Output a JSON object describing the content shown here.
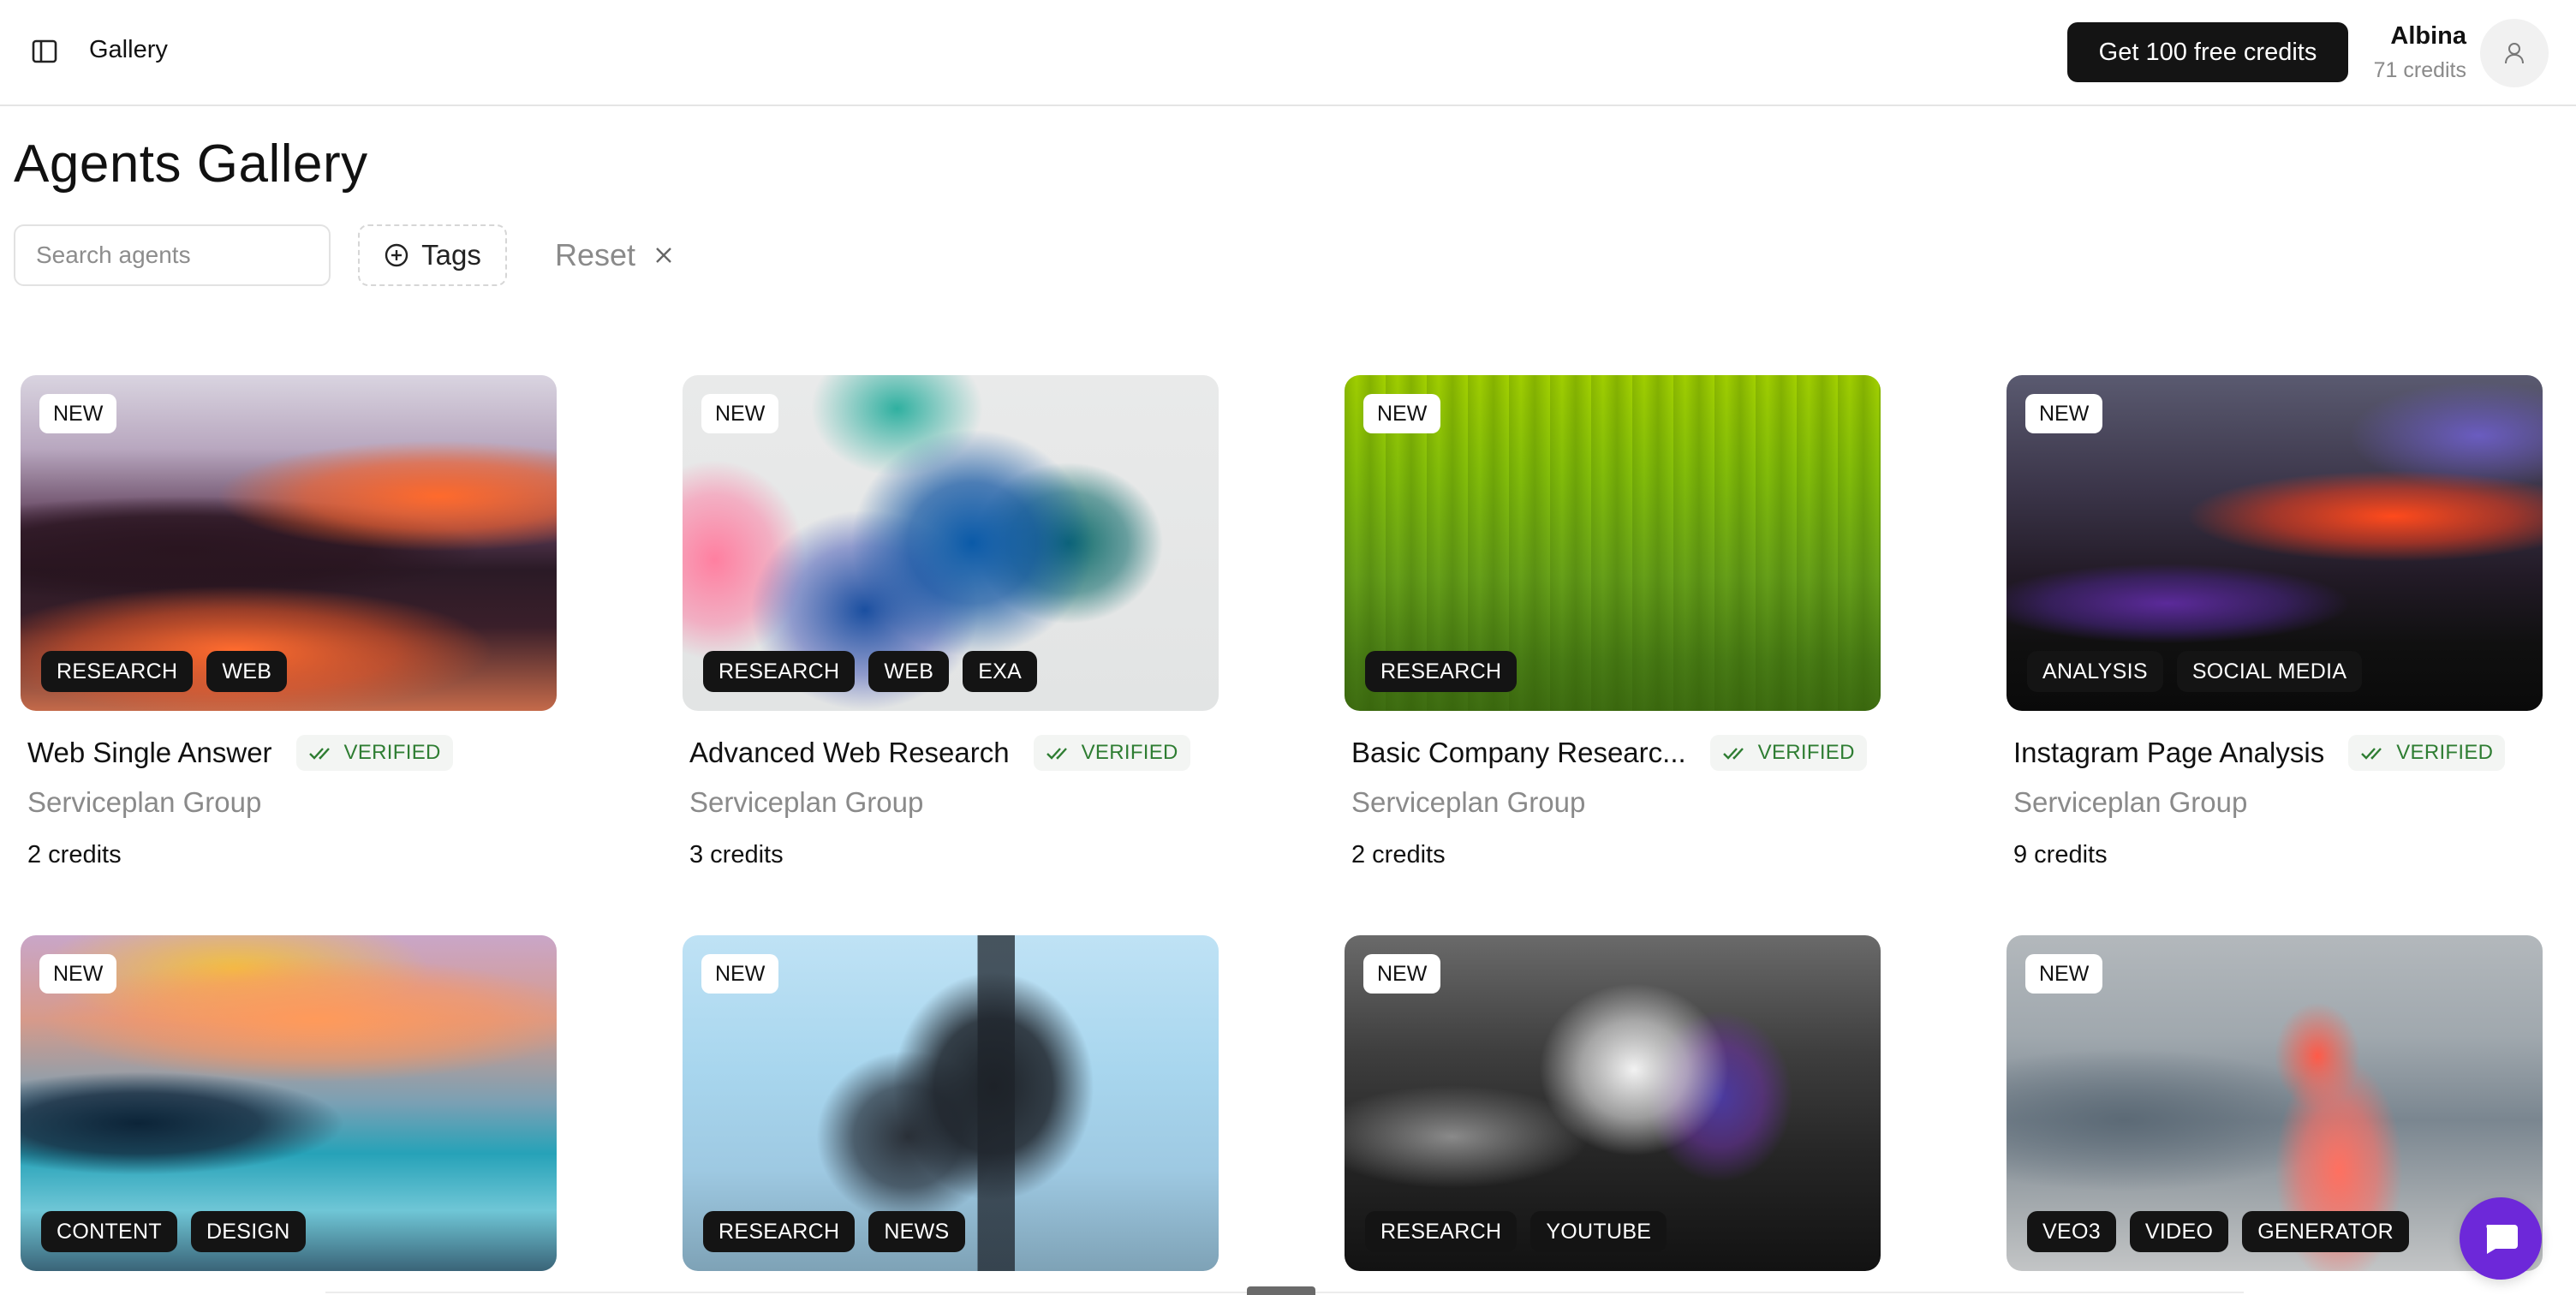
{
  "header": {
    "breadcrumb": "Gallery",
    "cta_label": "Get 100 free credits",
    "user_name": "Albina",
    "user_credits": "71 credits"
  },
  "page": {
    "title": "Agents Gallery"
  },
  "filters": {
    "search_placeholder": "Search agents",
    "tags_label": "Tags",
    "reset_label": "Reset"
  },
  "badges": {
    "new": "NEW",
    "verified": "VERIFIED"
  },
  "cards": [
    {
      "title": "Web Single Answer",
      "verified": true,
      "org": "Serviceplan Group",
      "price": "2 credits",
      "tags": [
        "RESEARCH",
        "WEB"
      ]
    },
    {
      "title": "Advanced Web Research",
      "verified": true,
      "org": "Serviceplan Group",
      "price": "3 credits",
      "tags": [
        "RESEARCH",
        "WEB",
        "EXA"
      ]
    },
    {
      "title": "Basic Company Researc...",
      "verified": true,
      "org": "Serviceplan Group",
      "price": "2 credits",
      "tags": [
        "RESEARCH"
      ]
    },
    {
      "title": "Instagram Page Analysis",
      "verified": true,
      "org": "Serviceplan Group",
      "price": "9 credits",
      "tags": [
        "ANALYSIS",
        "SOCIAL MEDIA"
      ]
    },
    {
      "tags": [
        "CONTENT",
        "DESIGN"
      ]
    },
    {
      "tags": [
        "RESEARCH",
        "NEWS"
      ]
    },
    {
      "tags": [
        "RESEARCH",
        "YOUTUBE"
      ]
    },
    {
      "tags": [
        "VEO3",
        "VIDEO",
        "GENERATOR"
      ]
    }
  ],
  "colors": {
    "primary_button": "#141414",
    "verified_green": "#2e7d32",
    "chat_purple": "#6d28d9"
  },
  "icons": {
    "sidebar_toggle": "sidebar-toggle-icon",
    "avatar": "user-icon",
    "tags": "plus-circle-icon",
    "reset": "close-icon",
    "verified": "double-check-icon",
    "chat": "chat-icon"
  }
}
